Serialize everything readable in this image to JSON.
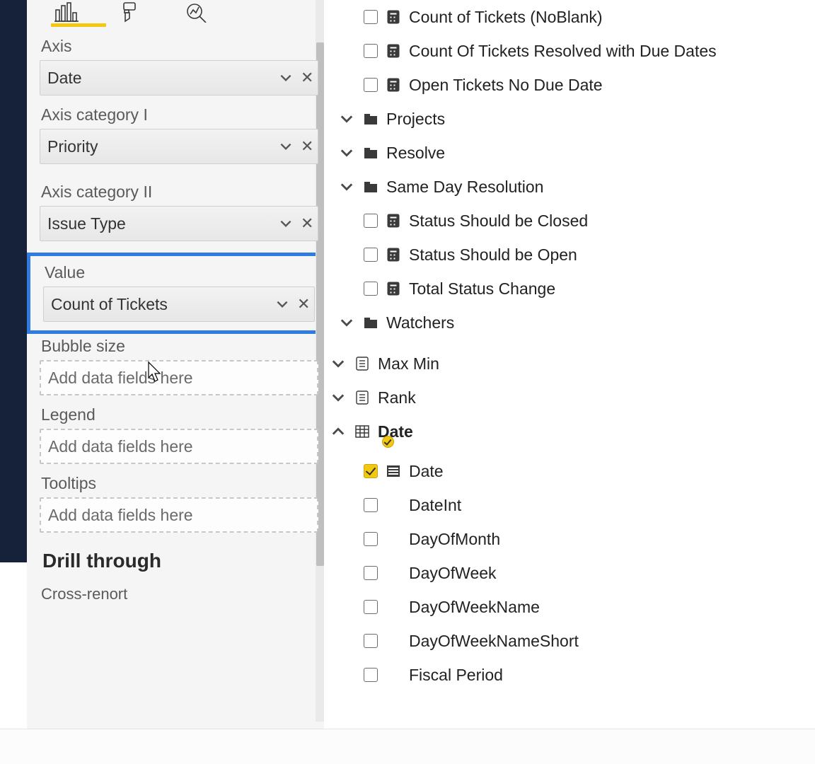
{
  "viz_panel": {
    "wells": {
      "axis": {
        "label": "Axis",
        "value": "Date"
      },
      "axis_cat_1": {
        "label": "Axis category I",
        "value": "Priority"
      },
      "axis_cat_2": {
        "label": "Axis category II",
        "value": "Issue Type"
      },
      "value": {
        "label": "Value",
        "value": "Count of Tickets"
      },
      "bubble_size": {
        "label": "Bubble size",
        "placeholder": "Add data fields here"
      },
      "legend": {
        "label": "Legend",
        "placeholder": "Add data fields here"
      },
      "tooltips": {
        "label": "Tooltips",
        "placeholder": "Add data fields here"
      }
    },
    "drill_through": "Drill through",
    "cross_report": "Cross-renort"
  },
  "fields_panel": {
    "measures_top": [
      "Count of Tickets (NoBlank)",
      "Count Of Tickets Resolved with Due Dates",
      "Open Tickets No Due Date"
    ],
    "folders": {
      "projects": "Projects",
      "resolve": "Resolve",
      "same_day": "Same Day Resolution",
      "watchers": "Watchers"
    },
    "same_day_children": [
      "Status Should be Closed",
      "Status Should be Open",
      "Total Status Change"
    ],
    "root_measures": [
      "Max Min",
      "Rank"
    ],
    "date_table": {
      "name": "Date",
      "columns": [
        {
          "name": "Date",
          "checked": true,
          "icon": "hier"
        },
        {
          "name": "DateInt",
          "checked": false,
          "icon": "none"
        },
        {
          "name": "DayOfMonth",
          "checked": false,
          "icon": "none"
        },
        {
          "name": "DayOfWeek",
          "checked": false,
          "icon": "none"
        },
        {
          "name": "DayOfWeekName",
          "checked": false,
          "icon": "none"
        },
        {
          "name": "DayOfWeekNameShort",
          "checked": false,
          "icon": "none"
        },
        {
          "name": "Fiscal Period",
          "checked": false,
          "icon": "none"
        }
      ]
    }
  }
}
